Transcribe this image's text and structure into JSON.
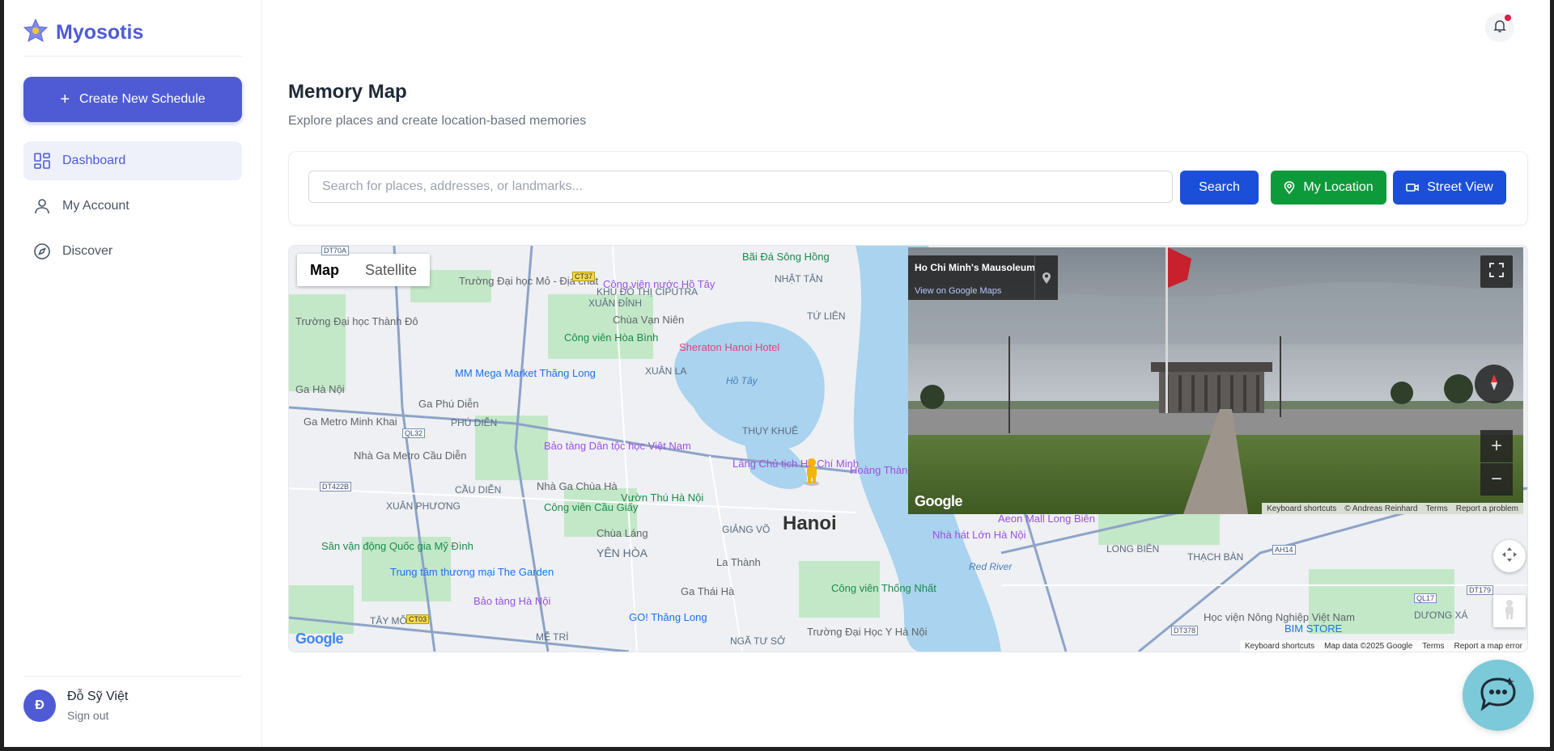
{
  "app": {
    "name": "Myosotis",
    "brand_color": "#4f5bd5"
  },
  "sidebar": {
    "create_label": "Create New Schedule",
    "items": [
      {
        "label": "Dashboard",
        "icon": "dashboard-icon",
        "active": true
      },
      {
        "label": "My Account",
        "icon": "user-icon",
        "active": false
      },
      {
        "label": "Discover",
        "icon": "compass-icon",
        "active": false
      }
    ],
    "user": {
      "initial": "Đ",
      "name": "Đỗ Sỹ Việt",
      "sign_out": "Sign out"
    }
  },
  "header": {
    "notification_icon": "bell-icon",
    "has_unread": true
  },
  "page": {
    "title": "Memory Map",
    "subtitle": "Explore places and create location-based memories"
  },
  "search": {
    "placeholder": "Search for places, addresses, or landmarks...",
    "value": "",
    "search_label": "Search",
    "my_location_label": "My Location",
    "street_view_label": "Street View",
    "colors": {
      "search": "#1b4fd9",
      "location": "#0d9a3a",
      "street": "#1b4fd9"
    }
  },
  "map": {
    "type_buttons": [
      "Map",
      "Satellite"
    ],
    "selected_type": "Map",
    "city_label": "Hanoi",
    "labels": [
      "KHU ĐÔ THỊ CIPUTRA",
      "XUÂN ĐỈNH",
      "NHẬT TÂN",
      "TỨ LIÊN",
      "XUÂN LA",
      "PHÚ DIỄN",
      "THỤY KHUÊ",
      "CẦU DIỄN",
      "XUÂN PHƯƠNG",
      "YÊN HÒA",
      "GIẢNG VÕ",
      "TÂY MỖ",
      "MỄ TRÌ",
      "NGÃ TƯ SỞ",
      "LONG BIÊN",
      "THẠCH BÀN",
      "DƯƠNG XÁ",
      "Hồ Tây",
      "Red River"
    ],
    "pois": [
      {
        "name": "Bãi Đá Sông Hồng",
        "color": "#1a8a4a"
      },
      {
        "name": "Công viên nước Hồ Tây",
        "color": "#9b51e0"
      },
      {
        "name": "Chùa Vạn Niên",
        "color": "#5f6368"
      },
      {
        "name": "Sheraton Hanoi Hotel",
        "color": "#e8417b"
      },
      {
        "name": "Trường Đại học Mỏ - Địa chất",
        "color": "#5f6368"
      },
      {
        "name": "Công viên Hòa Bình",
        "color": "#1a8a4a"
      },
      {
        "name": "MM Mega Market Thăng Long",
        "color": "#1a73e8"
      },
      {
        "name": "Ga Phú Diễn",
        "color": "#5f6368"
      },
      {
        "name": "Ga Metro Minh Khai",
        "color": "#5f6368"
      },
      {
        "name": "Nhà Ga Metro Cầu Diễn",
        "color": "#5f6368"
      },
      {
        "name": "Bảo tàng Dân tộc học Việt Nam",
        "color": "#9b51e0"
      },
      {
        "name": "Lăng Chủ tịch Hồ Chí Minh",
        "color": "#9b51e0"
      },
      {
        "name": "Hoàng Thành Thăng Long",
        "color": "#9b51e0"
      },
      {
        "name": "Nhà Ga Chùa Hà",
        "color": "#5f6368"
      },
      {
        "name": "Vườn Thú Hà Nội",
        "color": "#1a8a4a"
      },
      {
        "name": "Công viên Cầu Giấy",
        "color": "#1a8a4a"
      },
      {
        "name": "Chùa Láng",
        "color": "#5f6368"
      },
      {
        "name": "Sân vận động Quốc gia Mỹ Đình",
        "color": "#1a8a4a"
      },
      {
        "name": "Trung tâm thương mại The Garden",
        "color": "#1a73e8"
      },
      {
        "name": "Bảo tàng Hà Nội",
        "color": "#9b51e0"
      },
      {
        "name": "GO! Thăng Long",
        "color": "#1a73e8"
      },
      {
        "name": "La Thành",
        "color": "#5f6368"
      },
      {
        "name": "Ga Thái Hà",
        "color": "#5f6368"
      },
      {
        "name": "Công viên Thống Nhất",
        "color": "#1a8a4a"
      },
      {
        "name": "Trường Đại Học Y Hà Nội",
        "color": "#5f6368"
      },
      {
        "name": "Aeon Mall Long Biên",
        "color": "#9b51e0"
      },
      {
        "name": "Nhà hát Lớn Hà Nội",
        "color": "#9b51e0"
      },
      {
        "name": "Học viện Nông Nghiệp Việt Nam",
        "color": "#5f6368"
      },
      {
        "name": "BIM STORE",
        "color": "#1a73e8"
      },
      {
        "name": "Trường Đại học Thành Đô",
        "color": "#5f6368"
      },
      {
        "name": "Ga Hà Nội",
        "color": "#5f6368"
      }
    ],
    "road_badges": [
      "DT70A",
      "CT37",
      "QL32",
      "DT422B",
      "CT03",
      "AH14",
      "QL17",
      "DT179",
      "DT378"
    ],
    "attribution": {
      "shortcuts": "Keyboard shortcuts",
      "data": "Map data ©2025 Google",
      "terms": "Terms",
      "report": "Report a map error"
    },
    "google": "Google"
  },
  "street_view": {
    "place": "Ho Chi Minh's Mausoleum",
    "link": "View on Google Maps",
    "attribution": {
      "shortcuts": "Keyboard shortcuts",
      "photo": "© Andreas Reinhard",
      "terms": "Terms",
      "report": "Report a problem"
    },
    "google": "Google"
  },
  "chat": {
    "icon": "chat-bubble-icon",
    "color": "#7bc9d9"
  }
}
